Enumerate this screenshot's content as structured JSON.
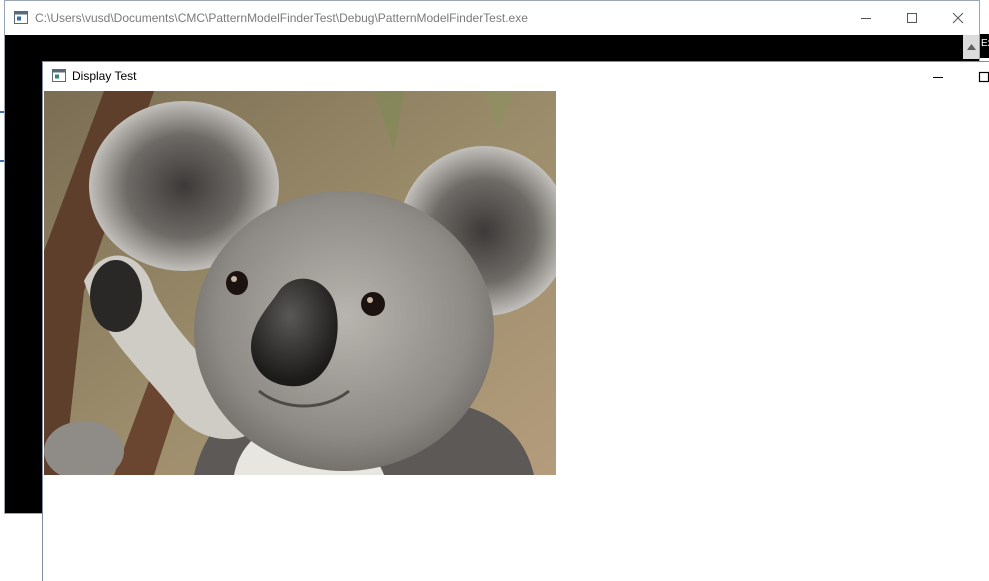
{
  "console_window": {
    "title": "C:\\Users\\vusd\\Documents\\CMC\\PatternModelFinderTest\\Debug\\PatternModelFinderTest.exe",
    "icon": "console-app-icon",
    "controls": [
      "minimize-icon",
      "maximize-icon",
      "close-icon"
    ]
  },
  "right_edge": {
    "label": "Ex"
  },
  "display_window": {
    "title": "Display Test",
    "icon": "image-window-icon",
    "controls": [
      "minimize-icon",
      "maximize-icon"
    ],
    "image": {
      "subject": "koala"
    }
  }
}
